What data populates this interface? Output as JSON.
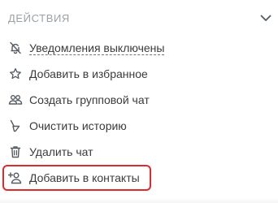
{
  "section": {
    "title": "ДЕЙСТВИЯ",
    "toggle_icon": "chevron-down-icon"
  },
  "menu": {
    "items": [
      {
        "label": "Уведомления выключены",
        "icon": "bell-off-icon",
        "dashed_underline": true
      },
      {
        "label": "Добавить в избранное",
        "icon": "star-icon"
      },
      {
        "label": "Создать групповой чат",
        "icon": "group-icon"
      },
      {
        "label": "Очистить историю",
        "icon": "broom-icon"
      },
      {
        "label": "Удалить чат",
        "icon": "trash-icon"
      },
      {
        "label": "Добавить в контакты",
        "icon": "add-contact-icon",
        "highlighted": true
      }
    ]
  },
  "colors": {
    "highlight_border": "#e0292b",
    "section_title": "#9aa0a6",
    "text": "#3b3b3b",
    "icon": "#555b61"
  }
}
